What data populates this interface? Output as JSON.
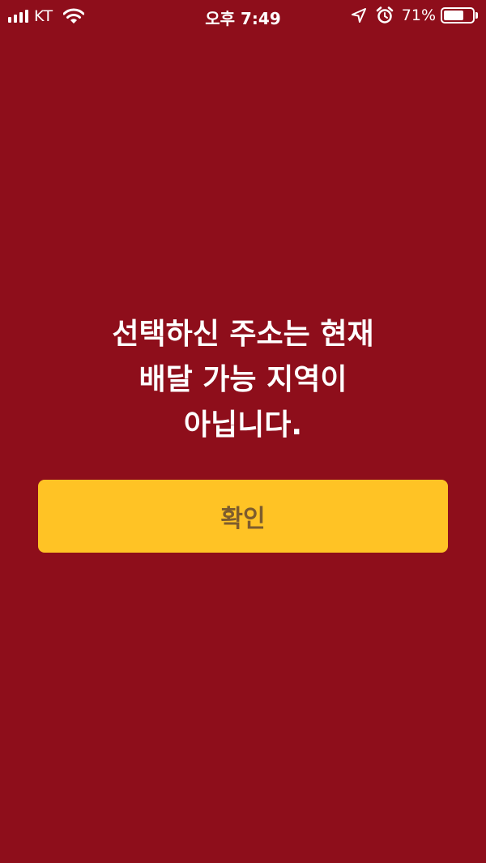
{
  "status_bar": {
    "carrier": "KT",
    "time": "오후 7:49",
    "battery_percent_label": "71%",
    "battery_level": 0.71,
    "icons": [
      "signal-icon",
      "wifi-icon",
      "location-arrow-icon",
      "alarm-clock-icon",
      "battery-icon"
    ]
  },
  "dialog": {
    "message_lines": [
      "선택하신 주소는 현재",
      "배달 가능 지역이",
      "아닙니다."
    ],
    "confirm_label": "확인"
  },
  "colors": {
    "background": "#8e0e1b",
    "button": "#ffc325",
    "button_text": "#7d5c2e",
    "text": "#ffffff"
  }
}
